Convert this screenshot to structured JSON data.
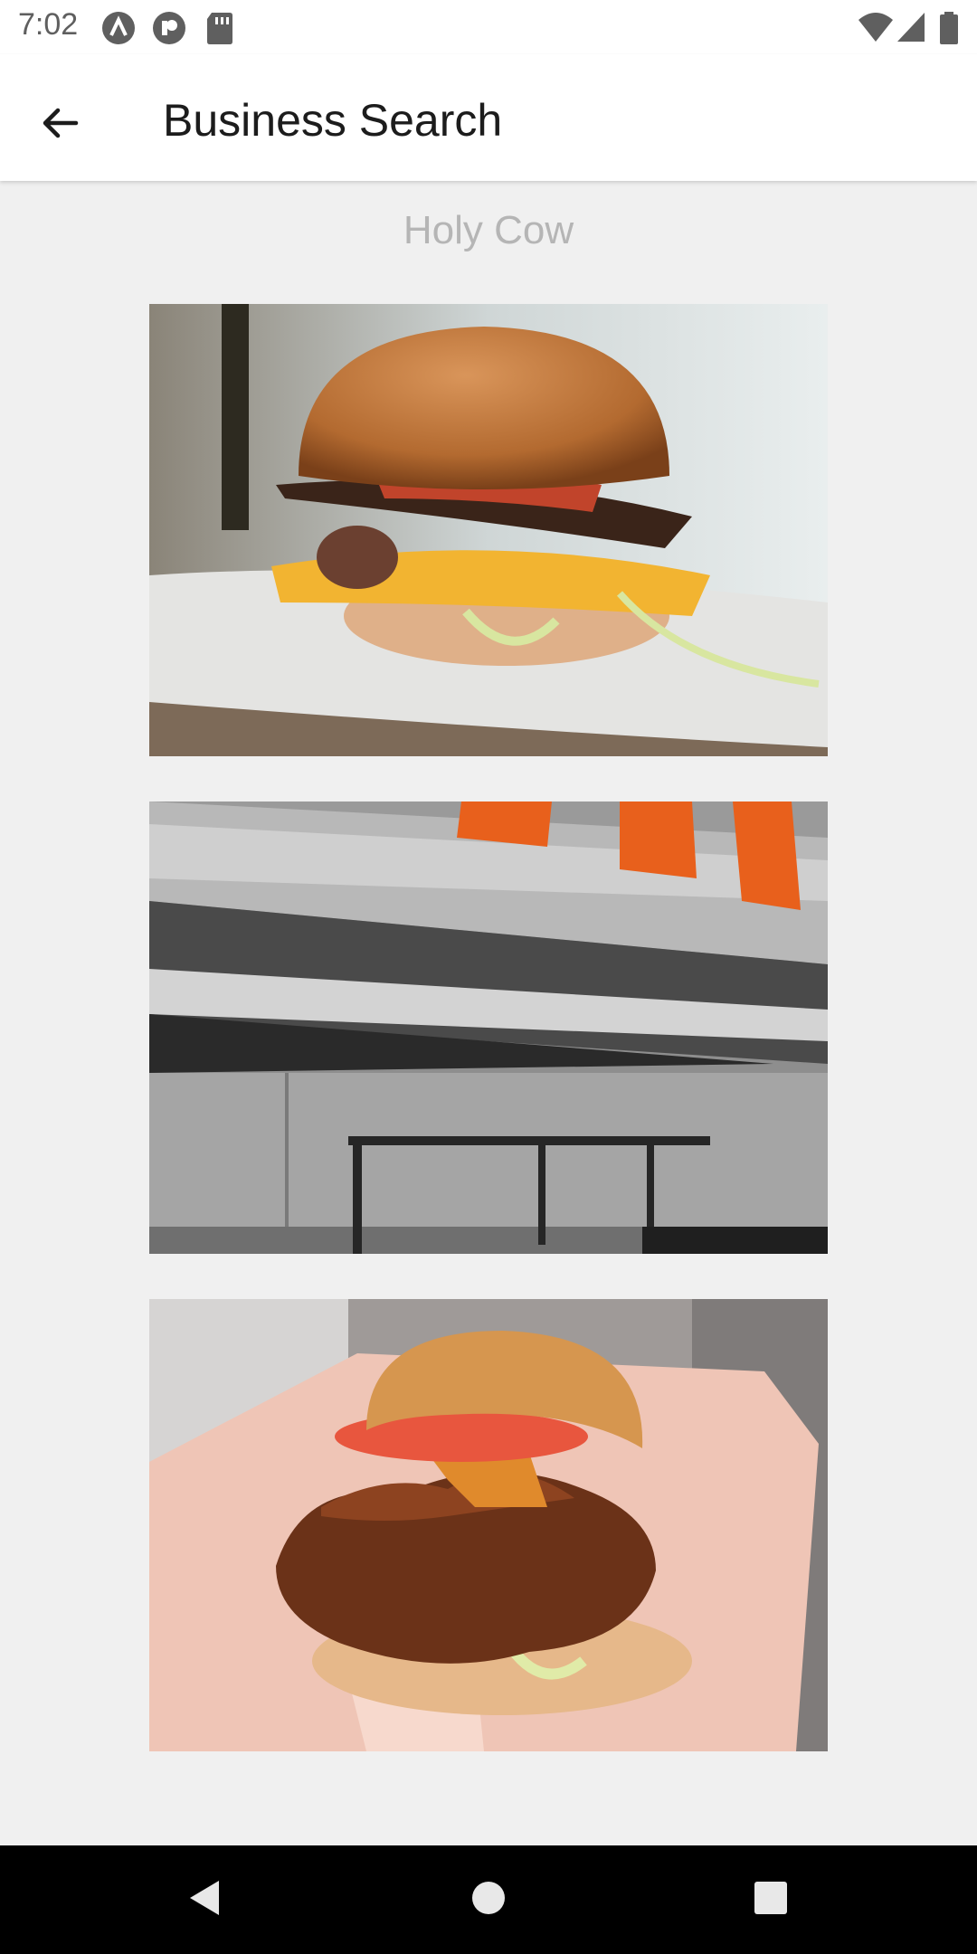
{
  "status_bar": {
    "time": "7:02",
    "left_icons": [
      "notification-a-icon",
      "notification-p-icon",
      "sd-card-icon"
    ],
    "right_icons": [
      "wifi-icon",
      "signal-icon",
      "battery-icon"
    ]
  },
  "app_bar": {
    "title": "Business Search",
    "back_icon": "arrow-back-icon"
  },
  "business": {
    "name": "Holy Cow",
    "photos": [
      "burger-photo",
      "kitchen-photo",
      "chicken-sandwich-photo"
    ]
  },
  "nav_bar": {
    "buttons": [
      "back-triangle-icon",
      "home-circle-icon",
      "recents-square-icon"
    ]
  },
  "colors": {
    "status_bar_bg": "#ffffff",
    "app_bar_bg": "#ffffff",
    "content_bg": "#f0f0f0",
    "nav_bar_bg": "#000000",
    "business_name": "#b5b5b5"
  }
}
